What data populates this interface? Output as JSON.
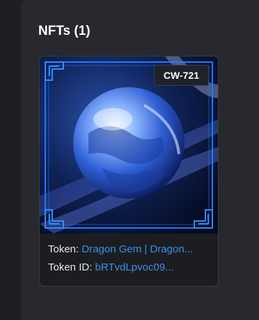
{
  "section": {
    "title": "NFTs (1)"
  },
  "nft_card": {
    "standard_badge": "CW-721",
    "image_icon": "dragon-gem-orb-image",
    "token_label": "Token:",
    "token_value": "Dragon Gem | Dragon...",
    "token_id_label": "Token ID:",
    "token_id_value": "bRTvdLpvoc09..."
  },
  "colors": {
    "background": "#1e1f23",
    "panel": "#28292e",
    "card": "#1c1d21",
    "link": "#3a8ee6",
    "frame_accent": "#1e7bff"
  }
}
